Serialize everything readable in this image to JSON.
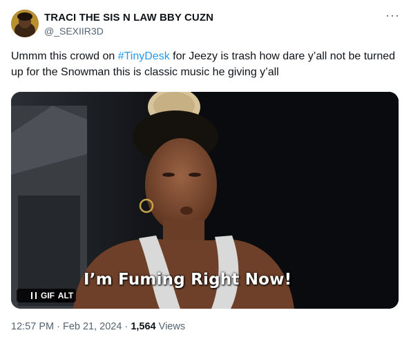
{
  "author": {
    "display_name": "TRACI THE SIS N LAW BBY CUZN",
    "handle": "@_SEXIIR3D"
  },
  "menu": {
    "more_label": "···"
  },
  "tweet": {
    "text_before": "Ummm this crowd on ",
    "hashtag": "#TinyDesk",
    "text_after": " for Jeezy is trash how dare y’all not be turned up for the Snowman this is classic music he giving y’all"
  },
  "media": {
    "caption": "I’m Fuming Right Now!",
    "gif_label": "GIF",
    "alt_label": "ALT"
  },
  "meta": {
    "time": "12:57 PM",
    "separator": " · ",
    "date": "Feb 21, 2024",
    "views_count": "1,564",
    "views_label": " Views"
  },
  "colors": {
    "link": "#1d9bf0",
    "secondary": "#536471",
    "text": "#0f1419"
  }
}
